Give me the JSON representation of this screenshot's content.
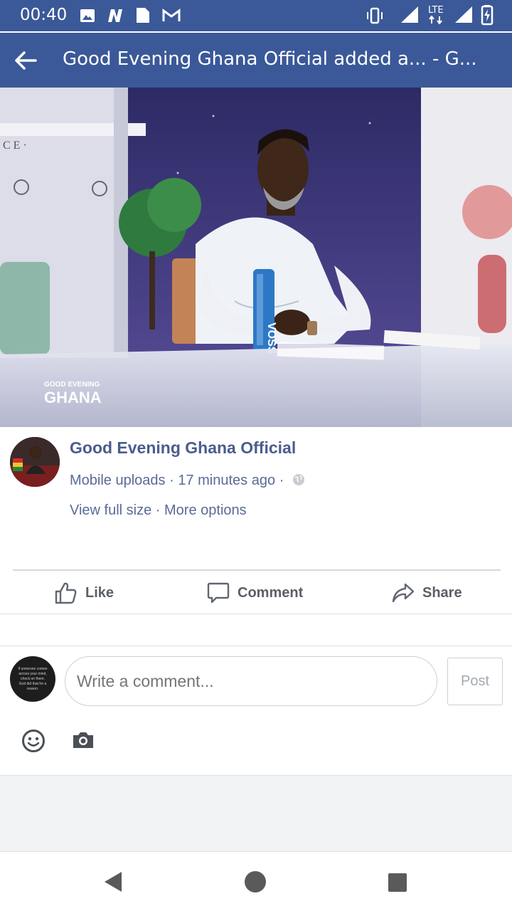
{
  "status_bar": {
    "time": "00:40",
    "network": "LTE",
    "icons": [
      "image-icon",
      "n-app-icon",
      "file-icon",
      "gmail-icon",
      "vibrate-icon",
      "signal-icon",
      "signal-icon",
      "battery-icon"
    ]
  },
  "app_bar": {
    "title": "Good Evening Ghana Official added a... - G...",
    "back_icon": "back-arrow-icon"
  },
  "photo": {
    "watermark_top": "GOOD EVENING",
    "watermark_bottom": "GHANA",
    "bottle_label": "VOSS",
    "wall_letters": "C E ·"
  },
  "post": {
    "author": "Good Evening Ghana Official",
    "source": "Mobile uploads",
    "separator": " · ",
    "time_ago": "17 minutes ago",
    "separator_end": " · ",
    "privacy_icon": "globe-icon",
    "view_full_size": "View full size",
    "more_options": "More options"
  },
  "actions": {
    "like": "Like",
    "comment": "Comment",
    "share": "Share"
  },
  "comment_box": {
    "placeholder": "Write a comment...",
    "post_label": "Post",
    "avatar_text": "If someone comes across your mind, check on them. God did that for a reason."
  },
  "colors": {
    "brand": "#3b5998",
    "link": "#5b6a98"
  }
}
